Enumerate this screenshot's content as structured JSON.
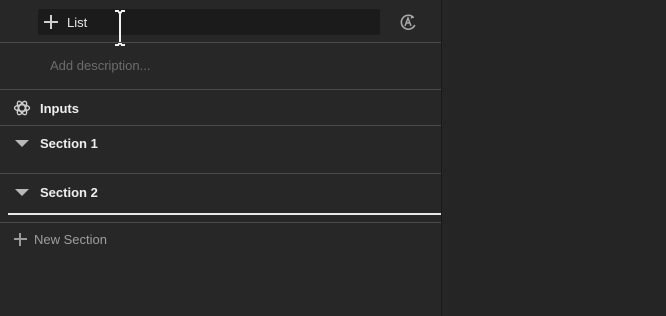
{
  "header": {
    "list_button_label": "List",
    "description_placeholder": "Add description..."
  },
  "sections": {
    "inputs_label": "Inputs",
    "section_1_label": "Section 1",
    "section_2_label": "Section 2",
    "new_section_label": "New Section"
  },
  "icons": {
    "add": "plus-icon",
    "auto": "auto-layout-icon",
    "inputs": "gear-icon",
    "collapse": "triangle-down-icon",
    "cursor": "text-cursor-icon"
  },
  "colors": {
    "background": "#272727",
    "field": "#1b1b1b",
    "divider": "#4a4a4a",
    "text": "#ededed",
    "muted": "#6c6c6c"
  }
}
